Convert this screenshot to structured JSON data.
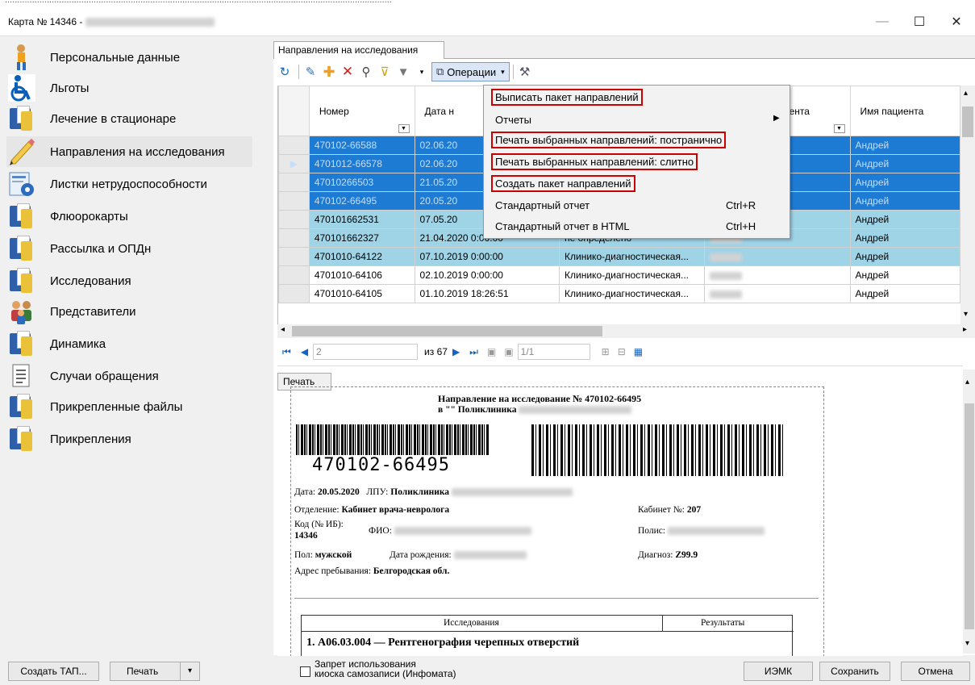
{
  "window": {
    "title_prefix": "Карта № 14346 -",
    "minimize_glyph": "—",
    "maximize_glyph": "☐",
    "close_glyph": "✕"
  },
  "sidebar": {
    "items": [
      {
        "label": "Персональные данные",
        "icon": "person-icon"
      },
      {
        "label": "Льготы",
        "icon": "wheelchair-icon"
      },
      {
        "label": "Лечение в стационаре",
        "icon": "folder-icon"
      },
      {
        "label": "Направления на исследования",
        "icon": "pencil-icon"
      },
      {
        "label": "Листки нетрудоспособности",
        "icon": "certificate-icon"
      },
      {
        "label": "Флюорокарты",
        "icon": "folder-icon"
      },
      {
        "label": "Рассылка и ОПДн",
        "icon": "folder-icon"
      },
      {
        "label": "Исследования",
        "icon": "folder-icon"
      },
      {
        "label": "Представители",
        "icon": "people-icon"
      },
      {
        "label": "Динамика",
        "icon": "folder-icon"
      },
      {
        "label": "Случаи обращения",
        "icon": "document-icon"
      },
      {
        "label": "Прикрепленные файлы",
        "icon": "folder-icon"
      },
      {
        "label": "Прикрепления",
        "icon": "folder-icon"
      }
    ]
  },
  "tab": {
    "label": "Направления на исследования"
  },
  "toolbar": {
    "operations_label": "Операции"
  },
  "grid": {
    "columns": [
      "Номер",
      "Дата н",
      "",
      "иента",
      "Имя пациента"
    ],
    "rows": [
      {
        "num": "470102-66588",
        "date": "02.06.20",
        "type": "",
        "name": "Андрей",
        "style": "sel-dark"
      },
      {
        "num": "4701012-66578",
        "date": "02.06.20",
        "type": "",
        "name": "Андрей",
        "style": "sel-dark"
      },
      {
        "num": "47010266503",
        "date": "21.05.20",
        "type": "",
        "name": "Андрей",
        "style": "sel-dark"
      },
      {
        "num": "470102-66495",
        "date": "20.05.20",
        "type": "",
        "name": "Андрей",
        "style": "sel-dark"
      },
      {
        "num": "470101662531",
        "date": "07.05.20",
        "type": "",
        "name": "Андрей",
        "style": "sel-light"
      },
      {
        "num": "470101662327",
        "date": "21.04.2020 0:00:00",
        "type": "не определено",
        "name": "Андрей",
        "style": "sel-light"
      },
      {
        "num": "4701010-64122",
        "date": "07.10.2019 0:00:00",
        "type": "Клинико-диагностическая...",
        "name": "Андрей",
        "style": "sel-light"
      },
      {
        "num": "4701010-64106",
        "date": "02.10.2019 0:00:00",
        "type": "Клинико-диагностическая...",
        "name": "Андрей",
        "style": "norm"
      },
      {
        "num": "4701010-64105",
        "date": "01.10.2019 18:26:51",
        "type": "Клинико-диагностическая...",
        "name": "Андрей",
        "style": "norm"
      }
    ]
  },
  "menu": {
    "items": [
      {
        "label": "Выписать пакет направлений",
        "shortcut": "",
        "highlight": true
      },
      {
        "label": "Отчеты",
        "shortcut": "",
        "highlight": false,
        "submenu": true
      },
      {
        "label": "Печать выбранных направлений: постранично",
        "shortcut": "",
        "highlight": true
      },
      {
        "label": "Печать выбранных направлений: слитно",
        "shortcut": "",
        "highlight": true
      },
      {
        "label": "Создать пакет направлений",
        "shortcut": "",
        "highlight": true
      },
      {
        "label": "Стандартный отчет",
        "shortcut": "Ctrl+R",
        "highlight": false
      },
      {
        "label": "Стандартный отчет в HTML",
        "shortcut": "Ctrl+H",
        "highlight": false
      }
    ]
  },
  "nav": {
    "page": "2",
    "of": "из 67",
    "page_ratio": "1/1"
  },
  "preview": {
    "print_label": "Печать",
    "heading1": "Направление на исследование № 470102-66495",
    "heading2": "в \"\" Поликлиника",
    "barcode_text": "470102-66495",
    "date_label": "Дата:",
    "date_value": "20.05.2020",
    "lpu_label": "ЛПУ:",
    "lpu_value": "Поликлиника",
    "dept_label": "Отделение:",
    "dept_value": "Кабинет врача-невролога",
    "cab_label": "Кабинет №:",
    "cab_value": "207",
    "code_label": "Код (№ ИБ):",
    "code_value": "14346",
    "fio_label": "ФИО:",
    "polis_label": "Полис:",
    "sex_label": "Пол:",
    "sex_value": "мужской",
    "birth_label": "Дата рождения:",
    "diag_label": "Диагноз:",
    "diag_value": "Z99.9",
    "addr_label": "Адрес пребывания:",
    "addr_value": "Белгородская обл.",
    "tbl_col1": "Исследования",
    "tbl_col2": "Результаты",
    "row1": "1. А06.03.004 — Рентгенография черепных отверстий"
  },
  "bottom": {
    "create_tap": "Создать ТАП...",
    "print": "Печать",
    "checkbox_line1": "Запрет использования",
    "checkbox_line2": "киоска самозаписи (Инфомата)",
    "iemk": "ИЭМК",
    "save": "Сохранить",
    "cancel": "Отмена"
  }
}
